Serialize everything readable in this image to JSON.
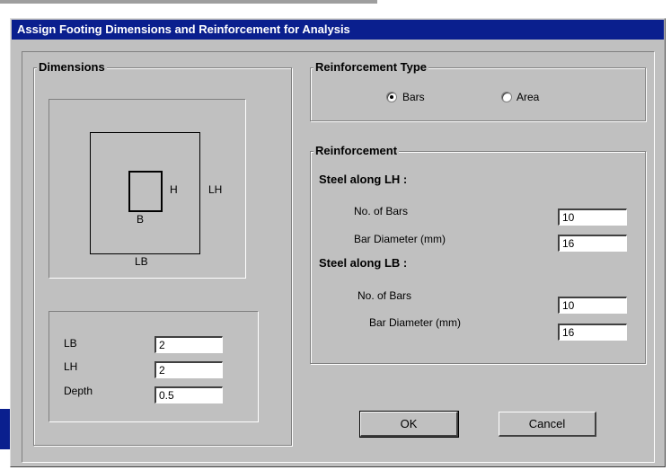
{
  "dialog": {
    "title": "Assign Footing Dimensions and Reinforcement for Analysis"
  },
  "dimensions": {
    "group_label": "Dimensions",
    "diagram": {
      "col_b": "B",
      "col_h": "H",
      "foot_lh": "LH",
      "foot_lb": "LB"
    },
    "fields": [
      {
        "label": "LB",
        "value": "2"
      },
      {
        "label": "LH",
        "value": "2"
      },
      {
        "label": "Depth",
        "value": "0.5"
      }
    ]
  },
  "reinforcement_type": {
    "group_label": "Reinforcement Type",
    "options": [
      {
        "label": "Bars",
        "selected": true
      },
      {
        "label": "Area",
        "selected": false
      }
    ]
  },
  "reinforcement": {
    "group_label": "Reinforcement",
    "lh": {
      "heading": "Steel along LH :",
      "bars_label": "No. of Bars",
      "bars_value": "10",
      "dia_label": "Bar Diameter (mm)",
      "dia_value": "16"
    },
    "lb": {
      "heading": "Steel along LB :",
      "bars_label": "No. of Bars",
      "bars_value": "10",
      "dia_label": "Bar Diameter (mm)",
      "dia_value": "16"
    }
  },
  "buttons": {
    "ok": "OK",
    "cancel": "Cancel"
  },
  "colors": {
    "titlebar": "#0a1f8e",
    "face": "#c0c0c0"
  }
}
